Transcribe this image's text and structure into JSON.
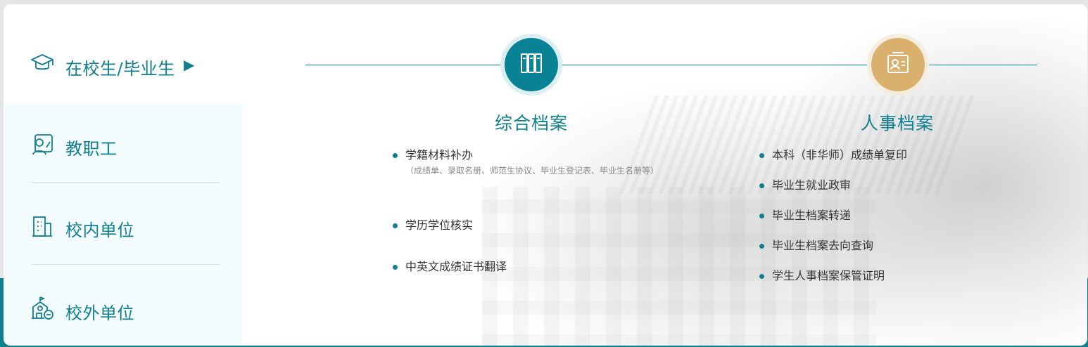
{
  "sidebar": {
    "items": [
      {
        "label": "在校生/毕业生",
        "icon": "graduation-cap-icon",
        "active": true
      },
      {
        "label": "教职工",
        "icon": "teacher-icon",
        "active": false
      },
      {
        "label": "校内单位",
        "icon": "building-icon",
        "active": false
      },
      {
        "label": "校外单位",
        "icon": "external-unit-icon",
        "active": false
      }
    ],
    "active_arrow": "▶"
  },
  "columns": [
    {
      "title": "综合档案",
      "icon": "binders-icon",
      "color": "#0a8295",
      "items": [
        {
          "label": "学籍材料补办",
          "note": "（成绩单、录取名册、师范生协议、毕业生登记表、毕业生名册等）"
        },
        {
          "label": "学历学位核实"
        },
        {
          "label": "中英文成绩证书翻译"
        }
      ]
    },
    {
      "title": "人事档案",
      "icon": "id-card-icon",
      "color": "#d9b06d",
      "items": [
        {
          "label": "本科（非华师）成绩单复印"
        },
        {
          "label": "毕业生就业政审"
        },
        {
          "label": "毕业生档案转递"
        },
        {
          "label": "毕业生档案去向查询"
        },
        {
          "label": "学生人事档案保管证明"
        }
      ]
    }
  ],
  "colors": {
    "accent": "#0f7f8f",
    "gold": "#d9b06d",
    "sidebar_bg": "#f3fcfe"
  }
}
